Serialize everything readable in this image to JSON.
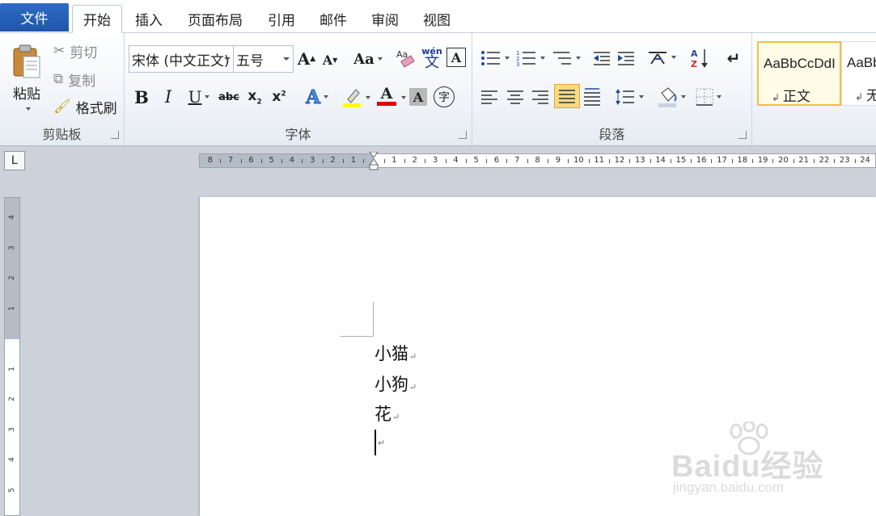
{
  "tabs": {
    "file": "文件",
    "items": [
      "开始",
      "插入",
      "页面布局",
      "引用",
      "邮件",
      "审阅",
      "视图"
    ]
  },
  "clipboard": {
    "paste": "粘贴",
    "cut": "剪切",
    "copy": "复制",
    "format_painter": "格式刷",
    "group_label": "剪贴板"
  },
  "font": {
    "font_name": "宋体 (中文正文)",
    "font_size": "五号",
    "group_label": "字体",
    "bold": "B",
    "italic": "I",
    "underline": "U",
    "strike": "abc",
    "case": "Aa",
    "grow": "A",
    "shrink": "A",
    "char_border": "A",
    "text_effect": "A",
    "font_color": "A",
    "char_shade": "A",
    "enclose": "字",
    "phonetic_top": "wén",
    "phonetic_bottom": "文"
  },
  "paragraph": {
    "group_label": "段落"
  },
  "styles": {
    "normal_sample": "AaBbCcDdI",
    "normal_name": "正文",
    "nospace_sample": "AaBbC",
    "nospace_name": "无"
  },
  "ruler": {
    "corner_glyph": "L",
    "h_left": [
      "8",
      "7",
      "6",
      "5",
      "4",
      "3",
      "2",
      "1"
    ],
    "h_right": [
      "1",
      "2",
      "3",
      "4",
      "5",
      "6",
      "7",
      "8",
      "9",
      "10",
      "11",
      "12",
      "13",
      "14",
      "15",
      "16",
      "17",
      "18",
      "19",
      "20",
      "21",
      "22",
      "23",
      "24"
    ],
    "v_top": [
      "4",
      "3",
      "2",
      "1"
    ],
    "v_bottom": [
      "1",
      "2",
      "3",
      "4",
      "5"
    ]
  },
  "document": {
    "lines": [
      "小猫",
      "小狗",
      "花"
    ],
    "paragraph_mark": "↵"
  },
  "watermark": {
    "brand": "Baidu经验",
    "url": "jingyan.baidu.com"
  },
  "colors": {
    "file_tab": "#2a63b8",
    "highlight_yellow": "#ffff00",
    "font_color_red": "#e00000",
    "selected_style_border": "#f0c040"
  }
}
